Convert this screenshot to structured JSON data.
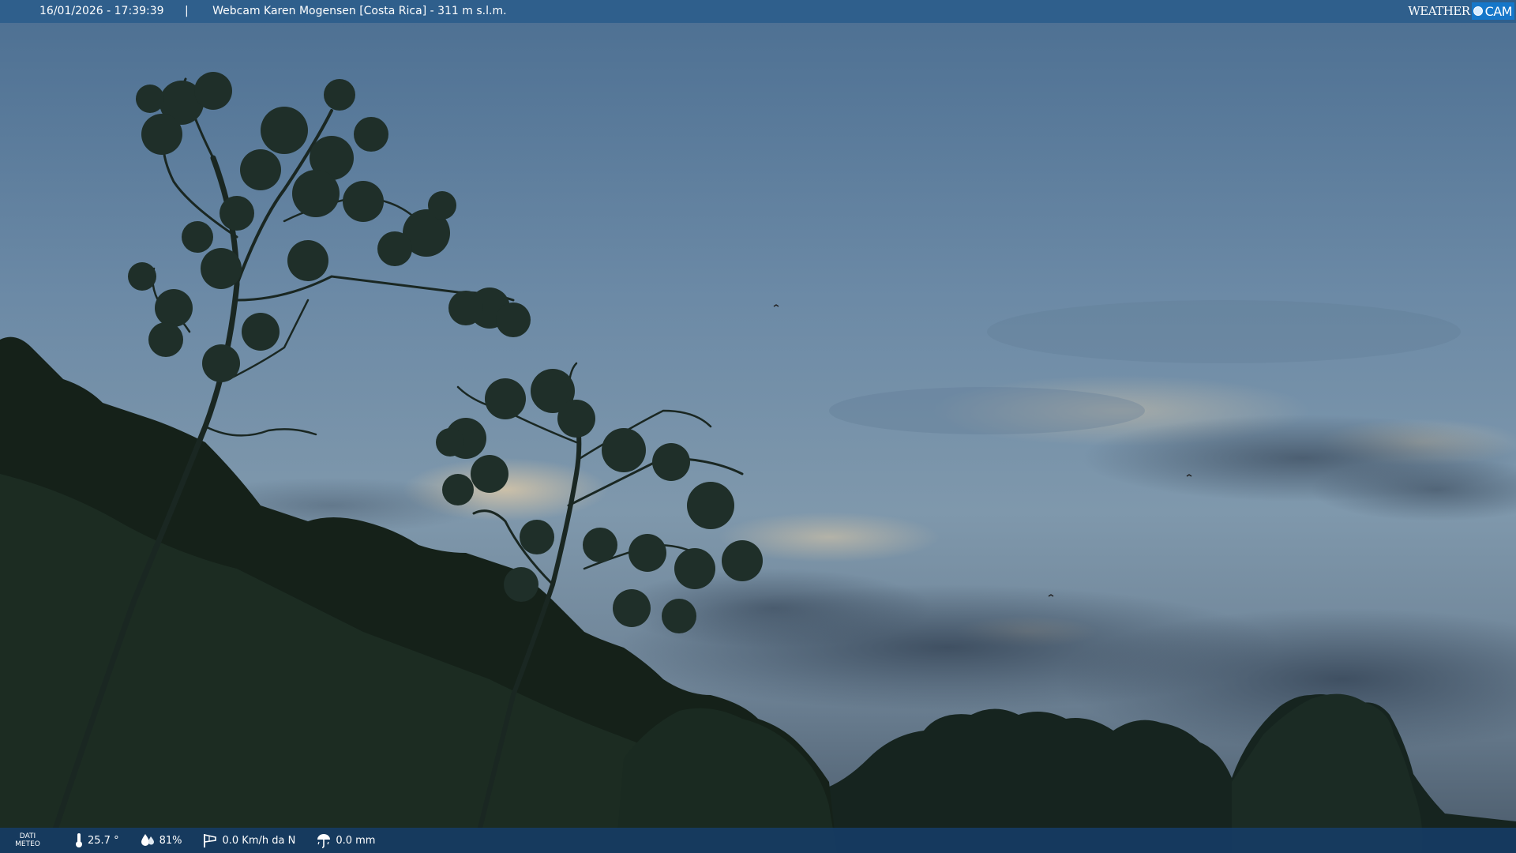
{
  "header": {
    "datetime": "16/01/2026 - 17:39:39",
    "separator": "|",
    "title": "Webcam Karen Mogensen [Costa Rica] - 311 m s.l.m.",
    "logo": {
      "text_part": "WEATHER",
      "badge_text": "CAM"
    }
  },
  "footer": {
    "dati_line1": "DATI",
    "dati_line2": "METEO",
    "temperature": "25.7 °",
    "humidity": "81%",
    "wind": "0.0 Km/h da N",
    "rain": "0.0 mm"
  },
  "icons": {
    "temperature": "thermometer-icon",
    "humidity": "water-drops-icon",
    "wind": "windsock-icon",
    "rain": "rain-umbrella-icon"
  },
  "colors": {
    "header_bar": "#2f5f8c",
    "footer_bar": "#163c64",
    "logo_badge": "#1677c9"
  }
}
